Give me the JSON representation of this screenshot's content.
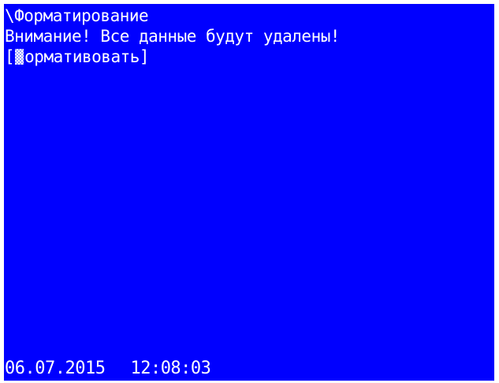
{
  "screen": {
    "background": "#0000ff",
    "foreground": "#ffffff",
    "path": "\\Форматирование",
    "warning": "Внимание! Все данные будут удалены!",
    "menu_item": {
      "bracket_open": "[",
      "label": "ормативовать",
      "bracket_close": "]"
    }
  },
  "status_bar": {
    "date": "06.07.2015",
    "time": "12:08:03"
  }
}
